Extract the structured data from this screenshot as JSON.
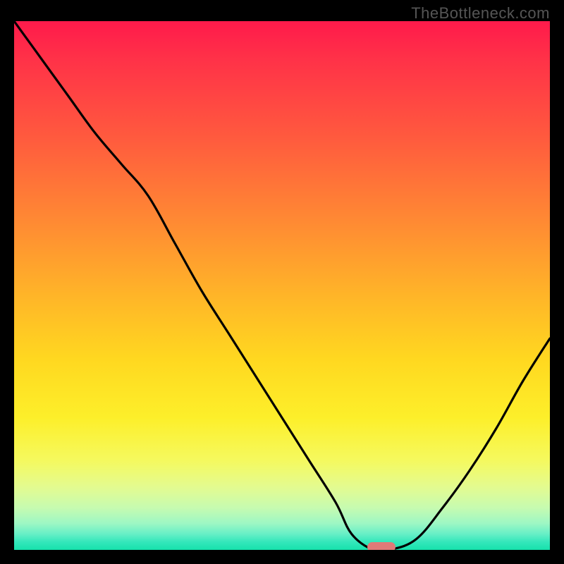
{
  "watermark": "TheBottleneck.com",
  "colors": {
    "frame": "#000000",
    "curve": "#000000",
    "marker": "#e07a78"
  },
  "chart_data": {
    "type": "line",
    "title": "",
    "xlabel": "",
    "ylabel": "",
    "xlim": [
      0,
      100
    ],
    "ylim": [
      0,
      100
    ],
    "grid": false,
    "series": [
      {
        "name": "bottleneck-curve",
        "x": [
          0,
          5,
          10,
          15,
          20,
          25,
          30,
          35,
          40,
          45,
          50,
          55,
          60,
          63,
          67,
          70,
          75,
          80,
          85,
          90,
          95,
          100
        ],
        "y": [
          100,
          93,
          86,
          79,
          73,
          67,
          58,
          49,
          41,
          33,
          25,
          17,
          9,
          3,
          0,
          0,
          2,
          8,
          15,
          23,
          32,
          40
        ]
      }
    ],
    "marker": {
      "x": 68.5,
      "y": 0.5
    }
  }
}
